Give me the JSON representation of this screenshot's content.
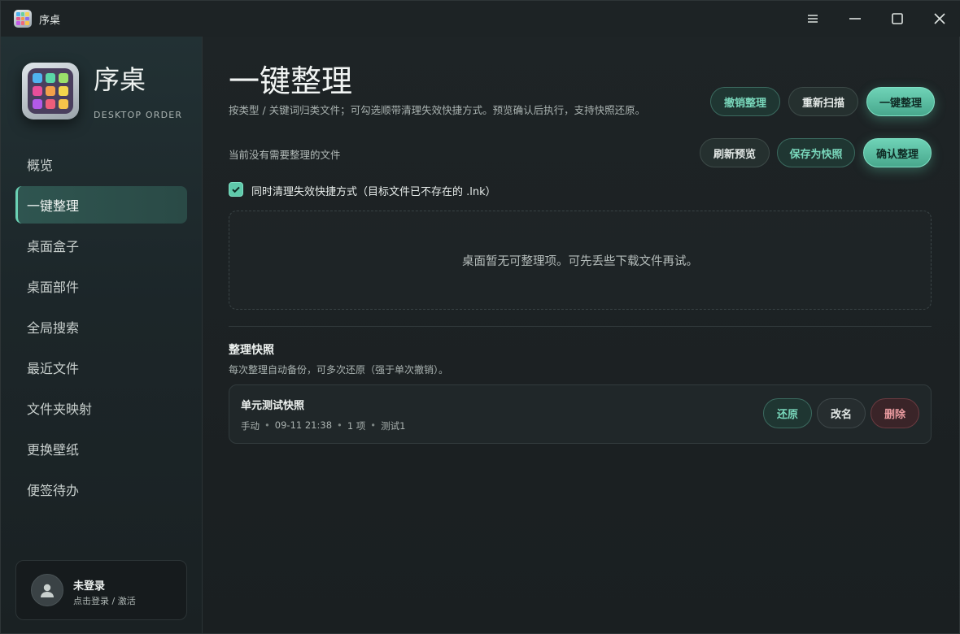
{
  "window": {
    "title": "序桌",
    "controls": {
      "menu": "menu-icon",
      "minimize": "minimize-icon",
      "maximize": "maximize-icon",
      "close": "close-icon"
    }
  },
  "sidebar": {
    "brand_name": "序桌",
    "brand_sub": "DESKTOP ORDER",
    "items": [
      {
        "label": "概览",
        "active": false
      },
      {
        "label": "一键整理",
        "active": true
      },
      {
        "label": "桌面盒子",
        "active": false
      },
      {
        "label": "桌面部件",
        "active": false
      },
      {
        "label": "全局搜索",
        "active": false
      },
      {
        "label": "最近文件",
        "active": false
      },
      {
        "label": "文件夹映射",
        "active": false
      },
      {
        "label": "更换壁纸",
        "active": false
      },
      {
        "label": "便签待办",
        "active": false
      }
    ],
    "user": {
      "name": "未登录",
      "hint": "点击登录 / 激活"
    }
  },
  "main": {
    "title": "一键整理",
    "description": "按类型 / 关键词归类文件；可勾选顺带清理失效快捷方式。预览确认后执行，支持快照还原。",
    "top_buttons": {
      "undo": "撤销整理",
      "rescan": "重新扫描",
      "organize": "一键整理"
    },
    "status": "当前没有需要整理的文件",
    "preview_buttons": {
      "refresh": "刷新预览",
      "save_snapshot": "保存为快照",
      "confirm": "确认整理"
    },
    "checkbox": {
      "checked": true,
      "label": "同时清理失效快捷方式（目标文件已不存在的 .lnk）"
    },
    "empty_message": "桌面暂无可整理项。可先丢些下载文件再试。",
    "snapshots": {
      "title": "整理快照",
      "description": "每次整理自动备份，可多次还原（强于单次撤销）。",
      "items": [
        {
          "name": "单元测试快照",
          "mode": "手动",
          "time": "09-11 21:38",
          "count": "1 项",
          "note": "测试1",
          "restore": "还原",
          "rename": "改名",
          "delete": "删除"
        }
      ]
    }
  },
  "colors": {
    "accent": "#6bd1b4",
    "danger": "#e99a9f",
    "background": "#1b2022"
  }
}
